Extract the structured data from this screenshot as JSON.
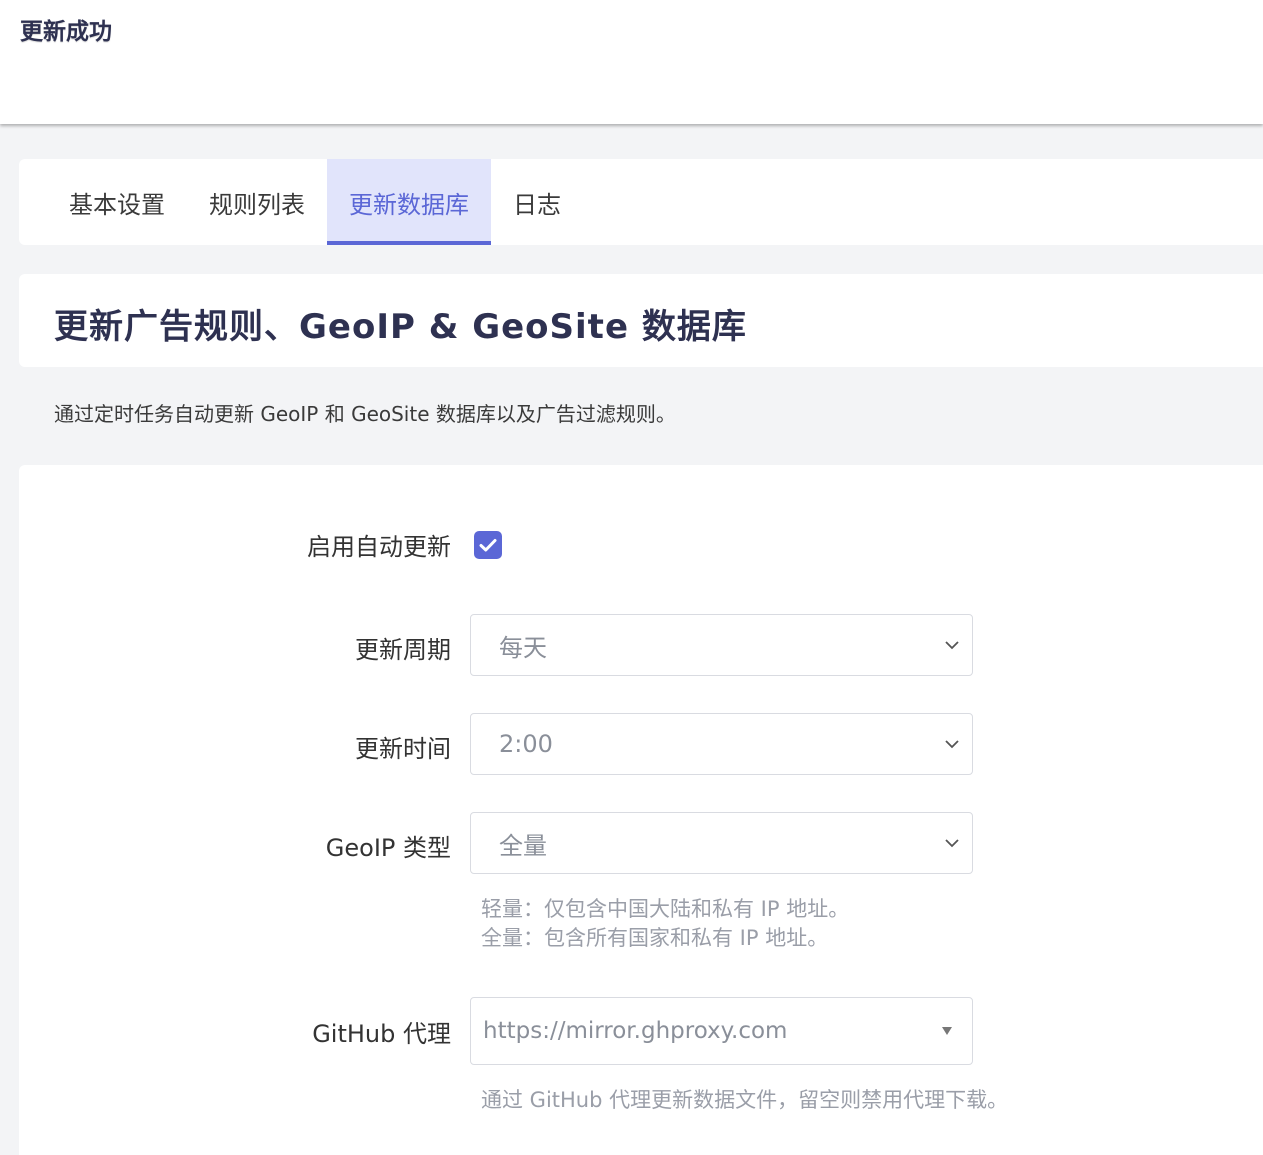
{
  "status_message": "更新成功",
  "tabs": [
    {
      "label": "基本设置",
      "active": false
    },
    {
      "label": "规则列表",
      "active": false
    },
    {
      "label": "更新数据库",
      "active": true
    },
    {
      "label": "日志",
      "active": false
    }
  ],
  "section": {
    "title": "更新广告规则、GeoIP & GeoSite 数据库",
    "description": "通过定时任务自动更新 GeoIP 和 GeoSite 数据库以及广告过滤规则。"
  },
  "form": {
    "auto_update": {
      "label": "启用自动更新",
      "checked": true
    },
    "update_cycle": {
      "label": "更新周期",
      "value": "每天"
    },
    "update_time": {
      "label": "更新时间",
      "value": "2:00"
    },
    "geoip_type": {
      "label": "GeoIP 类型",
      "value": "全量",
      "hint_lines": [
        "轻量：仅包含中国大陆和私有 IP 地址。",
        "全量：包含所有国家和私有 IP 地址。"
      ]
    },
    "github_proxy": {
      "label": "GitHub 代理",
      "value": "https://mirror.ghproxy.com",
      "hint": "通过 GitHub 代理更新数据文件，留空则禁用代理下载。"
    }
  },
  "colors": {
    "accent": "#5b67d6",
    "active_tab_bg": "#e1e4fb",
    "title": "#2e3151",
    "page_bg": "#f3f4f6"
  }
}
